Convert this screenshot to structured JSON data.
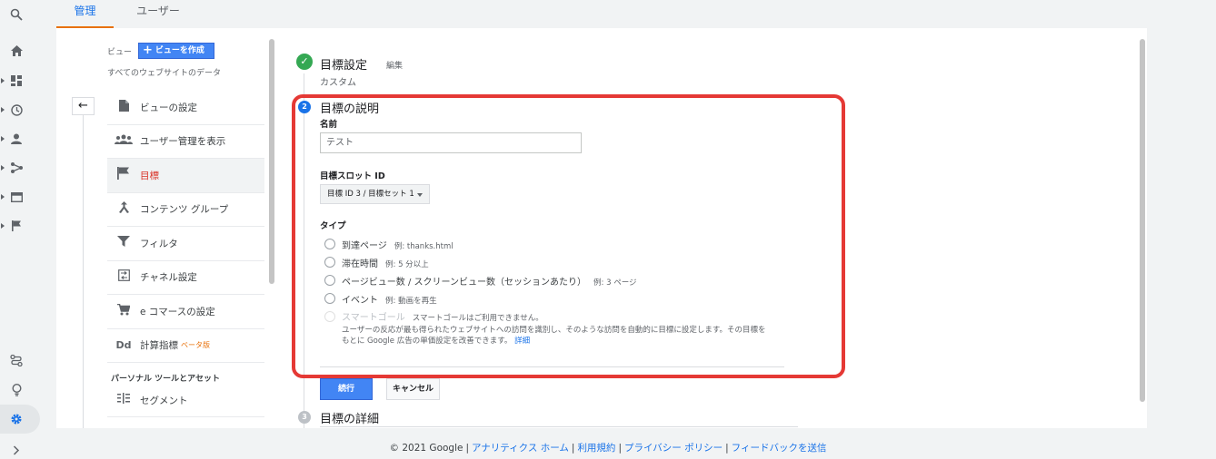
{
  "tabs": {
    "admin": "管理",
    "user": "ユーザー"
  },
  "left_panel": {
    "view_label": "ビュー",
    "create_view_button": "ビューを作成",
    "view_name": "すべてのウェブサイトのデータ",
    "back_icon": "←",
    "menu_items": [
      {
        "label": "ビューの設定",
        "icon": "document-icon"
      },
      {
        "label": "ユーザー管理を表示",
        "icon": "people-icon"
      },
      {
        "label": "目標",
        "icon": "flag-icon"
      },
      {
        "label": "コンテンツ グループ",
        "icon": "content-group-icon"
      },
      {
        "label": "フィルタ",
        "icon": "filter-icon"
      },
      {
        "label": "チャネル設定",
        "icon": "channel-icon"
      },
      {
        "label": "e コマースの設定",
        "icon": "cart-icon"
      },
      {
        "label": "計算指標",
        "icon": "calc-icon",
        "badge": "ベータ版"
      }
    ],
    "section_header": "パーソナル ツールとアセット",
    "segment_item": "セグメント"
  },
  "goal": {
    "step1": {
      "title": "目標設定",
      "edit": "編集",
      "subtitle": "カスタム"
    },
    "step2": {
      "number": "2",
      "title": "目標の説明",
      "name_label": "名前",
      "name_value": "テスト",
      "slot_label": "目標スロット ID",
      "slot_value": "目標 ID 3 / 目標セット 1",
      "type_label": "タイプ",
      "types": [
        {
          "label": "到達ページ",
          "example": "例: thanks.html"
        },
        {
          "label": "滞在時間",
          "example": "例: 5 分以上"
        },
        {
          "label": "ページビュー数 / スクリーンビュー数（セッションあたり）",
          "example": "例: 3 ページ"
        },
        {
          "label": "イベント",
          "example": "例: 動画を再生"
        }
      ],
      "smart_goal": {
        "label": "スマートゴール",
        "note": "スマートゴールはご利用できません。"
      },
      "smart_desc_1": "ユーザーの反応が最も得られたウェブサイトへの訪問を識別し、そのような訪問を自動的に目標に設定します。その目標を",
      "smart_desc_2": "もとに Google 広告の単価設定を改善できます。",
      "smart_desc_link": "詳細",
      "continue_button": "続行",
      "cancel_button": "キャンセル"
    },
    "step3": {
      "number": "3",
      "title": "目標の詳細"
    }
  },
  "footer": {
    "copyright": "© 2021 Google",
    "links": [
      "アナリティクス ホーム",
      "利用規約",
      "プライバシー ポリシー",
      "フィードバックを送信"
    ]
  },
  "colors": {
    "accent": "#1a73e8",
    "highlight": "#e53935",
    "success": "#34a853",
    "orange": "#e8710a"
  }
}
